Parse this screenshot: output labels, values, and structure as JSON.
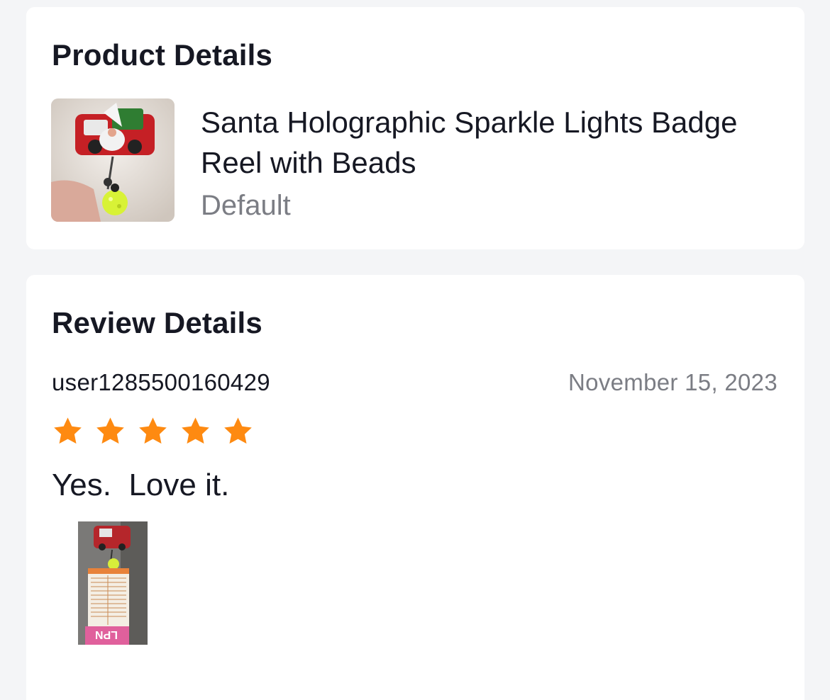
{
  "product_section": {
    "title": "Product Details",
    "product_name": "Santa Holographic Sparkle Lights Badge Reel with Beads",
    "variant": "Default"
  },
  "review_section": {
    "title": "Review Details",
    "username": "user1285500160429",
    "date": "November 15, 2023",
    "rating": 5,
    "rating_max": 5,
    "text": "Yes.  Love it.",
    "photo_badge_text": "LPN"
  },
  "colors": {
    "background": "#f4f5f7",
    "card": "#ffffff",
    "star": "#fe8a11",
    "secondary_text": "#7b7d84"
  }
}
